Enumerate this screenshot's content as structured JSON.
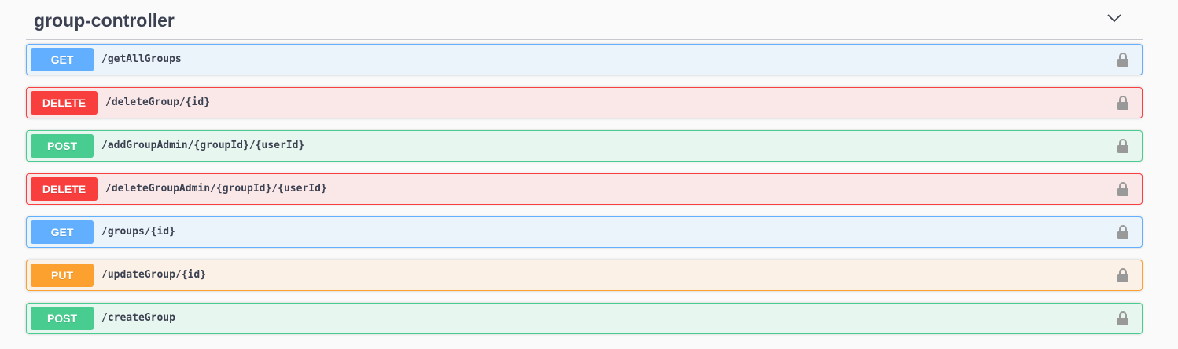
{
  "tag": {
    "title": "group-controller",
    "expand_icon": "chevron-down-icon"
  },
  "colors": {
    "get": "#61affe",
    "delete": "#f93e3e",
    "post": "#49cc90",
    "put": "#fca130",
    "text": "#3b4151",
    "lock": "#999999"
  },
  "operations": [
    {
      "method": "GET",
      "path": "/getAllGroups",
      "lock_icon": "lock-icon"
    },
    {
      "method": "DELETE",
      "path": "/deleteGroup/{id}",
      "lock_icon": "lock-icon"
    },
    {
      "method": "POST",
      "path": "/addGroupAdmin/{groupId}/{userId}",
      "lock_icon": "lock-icon"
    },
    {
      "method": "DELETE",
      "path": "/deleteGroupAdmin/{groupId}/{userId}",
      "lock_icon": "lock-icon"
    },
    {
      "method": "GET",
      "path": "/groups/{id}",
      "lock_icon": "lock-icon"
    },
    {
      "method": "PUT",
      "path": "/updateGroup/{id}",
      "lock_icon": "lock-icon"
    },
    {
      "method": "POST",
      "path": "/createGroup",
      "lock_icon": "lock-icon"
    }
  ]
}
